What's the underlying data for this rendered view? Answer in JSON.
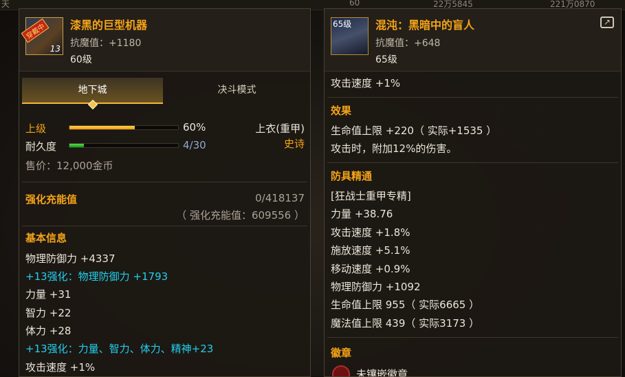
{
  "background": {
    "top_left_char": "天",
    "top_values": [
      "60",
      "22万5845",
      "221万0870"
    ]
  },
  "left_item": {
    "name": "漆黑的巨型机器",
    "icon_tag": "穿戴中",
    "icon_level": "13",
    "anti_magic": "抗魔值：+1180",
    "level": "60级",
    "tabs": [
      "地下城",
      "决斗模式"
    ],
    "grade_label": "上级",
    "grade_value": "60%",
    "grade_fraction": 0.6,
    "slot": "上衣(重甲)",
    "rarity": "史诗",
    "durability_label": "耐久度",
    "durability_value": "4/30",
    "durability_fraction": 0.1333,
    "sell_price": "售价：12,000金币",
    "charge_label": "强化充能值",
    "charge_value": "0/418137",
    "charge_sub": "（ 强化充能值：609556 ）",
    "basic_info_title": "基本信息",
    "stats": [
      {
        "text": "物理防御力 +4337",
        "color": "white"
      },
      {
        "text": "+13强化：物理防御力 +1793",
        "color": "cyan"
      },
      {
        "text": "力量 +31",
        "color": "white"
      },
      {
        "text": "智力 +22",
        "color": "white"
      },
      {
        "text": "体力 +28",
        "color": "white"
      },
      {
        "text": "+13强化：力量、智力、体力、精神+23",
        "color": "cyan"
      },
      {
        "text": "攻击速度 +1%",
        "color": "white"
      }
    ]
  },
  "right_item": {
    "name": "混沌：黑暗中的盲人",
    "icon_level": "65级",
    "anti_magic": "抗魔值：+648",
    "level": "65级",
    "first_line": "攻击速度 +1%",
    "effect_title": "效果",
    "effects": [
      "生命值上限 +220（ 实际+1535 ）",
      "攻击时，附加12%的伤害。"
    ],
    "mastery_title": "防具精通",
    "mastery_lines": [
      "[狂战士重甲专精]",
      "力量 +38.76",
      "攻击速度 +1.8%",
      "施放速度 +5.1%",
      "移动速度 +0.9%",
      "物理防御力 +1092",
      "生命值上限 955（ 实际6665 ）",
      "魔法值上限 439（ 实际3173 ）"
    ],
    "emblem_title": "徽章",
    "emblem_line": "未镶嵌徽章"
  }
}
